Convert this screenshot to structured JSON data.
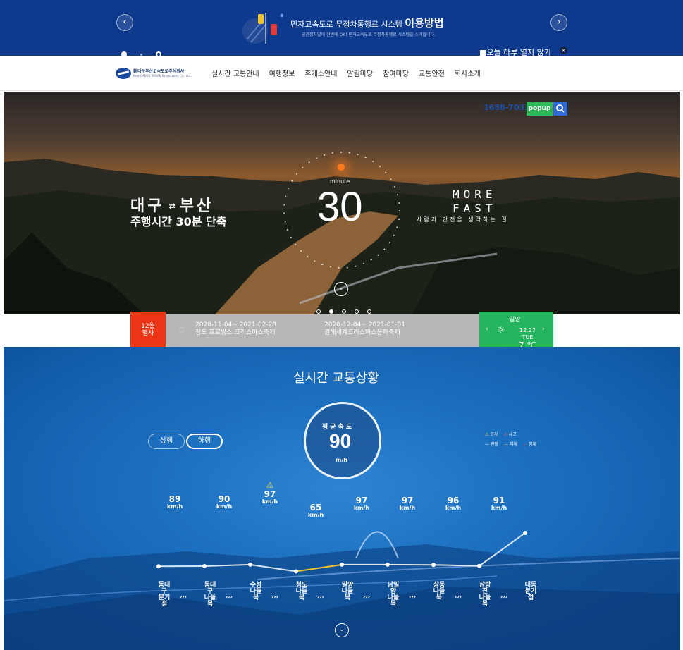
{
  "promo": {
    "title_prefix": "민자고속도로 무정차통행료 시스템",
    "title_emph": "이용방법",
    "subtitle": "공간정자말이 한번에 OK! 민자고속도로 무정차통행료 시스템을 소개합니다.",
    "today_close": "■오늘 하루 열지 않기",
    "close": "×",
    "prev": "‹",
    "next": "›"
  },
  "gnb": {
    "logo_name": "新대구부산고속도로주식회사",
    "logo_en": "New DAEGU BUSAN Expressway Co., Ltd.",
    "menu": [
      "실시간 교통안내",
      "여행정보",
      "휴게소안내",
      "알림마당",
      "참여마당",
      "교통안전",
      "회사소개"
    ]
  },
  "hero": {
    "phone": "1688-7033",
    "popup": "popup",
    "title_from": "대구",
    "title_arrows": "⇄",
    "title_to": "부산",
    "subtitle": "주행시간 30분 단축",
    "minute_label": "minute",
    "minutes": "30",
    "more": "MORE",
    "fast": "FAST",
    "tagline": "사람과 안전을 생각하는 길",
    "scroll": "⌄"
  },
  "events": {
    "month": "12월",
    "month_label": "행사",
    "up": "︿",
    "down": "﹀",
    "items": [
      {
        "date": "2020-11-04~ 2021-02-28",
        "name": "청도 프로방스 크리스마스축제"
      },
      {
        "date": "2020-12-04~ 2021-01-01",
        "name": "김해세계크리스마스문화축제"
      }
    ]
  },
  "weather": {
    "city": "밀양",
    "icon": "☼",
    "date": "12.27",
    "day": "TUE",
    "temp": "7.℃",
    "prev": "‹",
    "next": "›"
  },
  "traffic": {
    "title": "실시간 교통상황",
    "dir_up": "상행",
    "dir_down": "하행",
    "avg_label": "평균속도",
    "avg_value": "90",
    "avg_unit": "m/h",
    "legend": [
      {
        "symbol": "⚠",
        "label": "공사",
        "color": "#f5d23a"
      },
      {
        "symbol": "⚠",
        "label": "사고",
        "color": "#ff5a5a"
      },
      {
        "symbol": "—",
        "label": "원활",
        "color": "#ffffff"
      },
      {
        "symbol": "—",
        "label": "지체",
        "color": "#f2c230"
      },
      {
        "symbol": "—",
        "label": "정체",
        "color": "#ff4a4a"
      }
    ],
    "scroll": "⌄"
  },
  "chart_data": {
    "type": "line",
    "unit": "km/h",
    "points": [
      {
        "speed": 89,
        "label": "동대구분기점",
        "segment": "원활"
      },
      {
        "speed": 90,
        "label": "동대구나들목",
        "segment": "원활"
      },
      {
        "speed": 97,
        "label": "수성나들목",
        "segment": "원활",
        "construction": true
      },
      {
        "speed": 65,
        "label": "청도나들목",
        "segment": "지체"
      },
      {
        "speed": 97,
        "label": "밀양나들목",
        "segment": "원활"
      },
      {
        "speed": 97,
        "label": "남밀양나들목",
        "segment": "원활"
      },
      {
        "speed": 96,
        "label": "상동나들목",
        "segment": "원활"
      },
      {
        "speed": 91,
        "label": "삼랑진나들목",
        "segment": "원활"
      },
      {
        "speed": null,
        "label": "대동분기점"
      }
    ],
    "speed_labels": [
      {
        "value": "89",
        "unit": "km/h"
      },
      {
        "value": "90",
        "unit": "km/h"
      },
      {
        "value": "97",
        "unit": "km/h"
      },
      {
        "value": "65",
        "unit": "km/h"
      },
      {
        "value": "97",
        "unit": "km/h"
      },
      {
        "value": "97",
        "unit": "km/h"
      },
      {
        "value": "96",
        "unit": "km/h"
      },
      {
        "value": "91",
        "unit": "km/h"
      }
    ],
    "interchanges": [
      [
        "동대",
        "구",
        "분기",
        "점"
      ],
      [
        "동대",
        "구",
        "나들",
        "목"
      ],
      [
        "수성",
        "나들",
        "목"
      ],
      [
        "청도",
        "나들",
        "목"
      ],
      [
        "밀양",
        "나들",
        "목"
      ],
      [
        "남밀",
        "양",
        "나들",
        "목"
      ],
      [
        "상동",
        "나들",
        "목"
      ],
      [
        "삼랑",
        "진",
        "나들",
        "목"
      ],
      [
        "대동",
        "분기",
        "점"
      ]
    ],
    "separator": "›››",
    "colors": {
      "smooth": "#d9e6f5",
      "delay": "#f2c230"
    }
  }
}
